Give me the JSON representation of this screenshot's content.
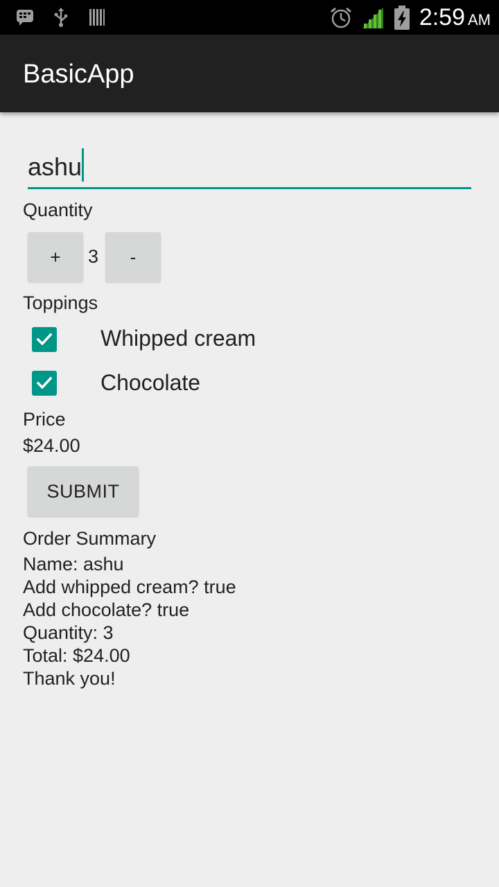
{
  "status_bar": {
    "time": "2:59",
    "ampm": "AM",
    "icons_left": [
      "bbm-icon",
      "usb-icon",
      "barcode-icon"
    ],
    "icons_right": [
      "alarm-icon",
      "signal-icon",
      "battery-charging-icon"
    ]
  },
  "app_bar": {
    "title": "BasicApp"
  },
  "form": {
    "name_value": "ashu",
    "quantity_label": "Quantity",
    "plus_label": "+",
    "quantity_value": "3",
    "minus_label": "-",
    "toppings_label": "Toppings",
    "toppings": [
      {
        "label": "Whipped cream",
        "checked": true
      },
      {
        "label": "Chocolate",
        "checked": true
      }
    ],
    "price_label": "Price",
    "price_value": "$24.00",
    "submit_label": "SUBMIT"
  },
  "summary": {
    "title": "Order Summary",
    "lines": [
      "Name: ashu",
      "Add whipped cream? true",
      "Add chocolate? true",
      "Quantity: 3",
      "Total: $24.00",
      "Thank you!"
    ]
  },
  "colors": {
    "accent": "#009688",
    "app_bar": "#212121",
    "background": "#eeeeee",
    "button": "#d6d7d7"
  }
}
